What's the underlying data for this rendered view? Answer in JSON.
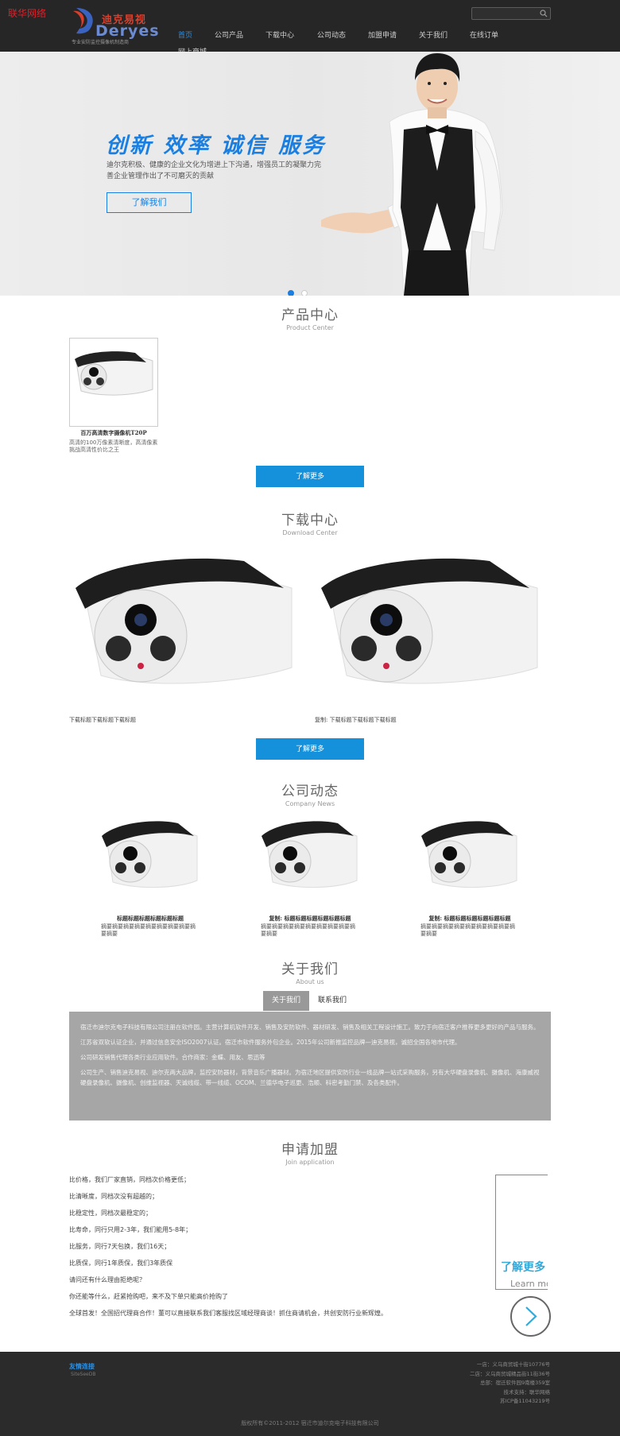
{
  "header": {
    "corner_brand": "联华网络",
    "logo": {
      "cn": "迪克易视",
      "en": "Deryes",
      "tagline": "专业安防监控摄像机制造商"
    },
    "search": {
      "placeholder": "",
      "icon": "search-icon"
    },
    "nav": [
      {
        "label": "首页",
        "active": true
      },
      {
        "label": "公司产品"
      },
      {
        "label": "下载中心"
      },
      {
        "label": "公司动态"
      },
      {
        "label": "加盟申请"
      },
      {
        "label": "关于我们"
      },
      {
        "label": "在线订单"
      },
      {
        "label": "网上商城"
      }
    ]
  },
  "banner": {
    "slogan": "创新 效率 诚信 服务",
    "desc": "迪尔克积极、健康的企业文化为增进上下沟通，增强员工的凝聚力完善企业管理作出了不可磨灭的贡献",
    "button": "了解我们",
    "slide_count": 2,
    "active_slide": 1
  },
  "products": {
    "title_cn": "产品中心",
    "title_en": "Product Center",
    "items": [
      {
        "name": "百万高清数字摄像机T20P",
        "desc": "高清的100万像素清晰度，高清像素挑战高清性价比之王"
      }
    ],
    "more_button": "了解更多"
  },
  "downloads": {
    "title_cn": "下载中心",
    "title_en": "Download Center",
    "items": [
      {
        "caption": "下载标题下载标题下载标题"
      },
      {
        "caption": "复制: 下载标题下载标题下载标题"
      }
    ],
    "more_button": "了解更多"
  },
  "news": {
    "title_cn": "公司动态",
    "title_en": "Company News",
    "items": [
      {
        "title": "标题标题标题标题标题标题",
        "desc": "摘要摘要摘要摘要摘要摘要摘要摘要摘要摘要"
      },
      {
        "title": "复制: 标题标题标题标题标题标题",
        "desc": "摘要摘要摘要摘要摘要摘要摘要摘要摘要摘要"
      },
      {
        "title": "复制: 标题标题标题标题标题标题",
        "desc": "摘要摘要摘要摘要摘要摘要摘要摘要摘要摘要"
      }
    ]
  },
  "about": {
    "title_cn": "关于我们",
    "title_en": "About us",
    "tabs": [
      "关于我们",
      "联系我们"
    ],
    "paragraphs": [
      "宿迁市迪尔克电子科技有限公司注册在软件园。主营计算机软件开发、销售及安防软件、器材研发、销售及相关工程设计施工。致力于向宿迁客户推荐更多更好的产品与服务。",
      "江苏省双软认证企业，并通过信息安全ISO2007认证。宿迁市软件服务外包企业。2015年公司新推监控品牌—迪克易视，诚招全国各地市代理。",
      "公司研发销售代理各类行业应用软件。合作商家：金蝶、用友、思迅等",
      "公司生产、销售迪克易视、迪尔克两大品牌，监控安防器材，背景音乐广播器材。为宿迁地区提供安防行业一线品牌一站式采购服务，另有大华硬盘录像机、摄像机、海康威视硬盘录像机、摄像机、创维监视器、天诚线缆、带一线缆、OCOM、兰德华电子巡更、浩顺、科密考勤门禁、及各类配件。"
    ]
  },
  "join": {
    "title_cn": "申请加盟",
    "title_en": "Join application",
    "lines": [
      "比价格，我们厂家直销，同档次价格更低；",
      "比清晰度，同档次没有超越的；",
      "比稳定性，同档次最稳定的；",
      "比寿命，同行只用2-3年，我们能用5-8年；",
      "比服务，同行7天包换，我们16天；",
      "比质保，同行1年质保，我们3年质保",
      "请问还有什么理由拒绝呢？",
      "你还能等什么，赶紧抢购吧，来不及下单只能高价抢购了",
      "全球首发！全国招代理商合作！董可以直接联系我们客服找区域经理商谈！抓住商请机会，共创安防行业新辉煌。"
    ],
    "card_title": "了解更多",
    "card_sub": "Learn more"
  },
  "footer": {
    "links_title": "友情连接",
    "links_en": "SiteSeeDB",
    "right_lines": [
      "一店：义乌商贸城十街10776号",
      "二店：义乌商贸城精品街11街36号",
      "总部：宿迁软件园9南楼359室",
      "技术支持：联华网络",
      "苏ICP备11043219号"
    ],
    "copyright": "版权所有©2011-2012 宿迁市迪尔克电子科技有限公司"
  },
  "colors": {
    "accent": "#1591db",
    "brand_red": "#d8402e",
    "dark_bg": "#262626"
  }
}
